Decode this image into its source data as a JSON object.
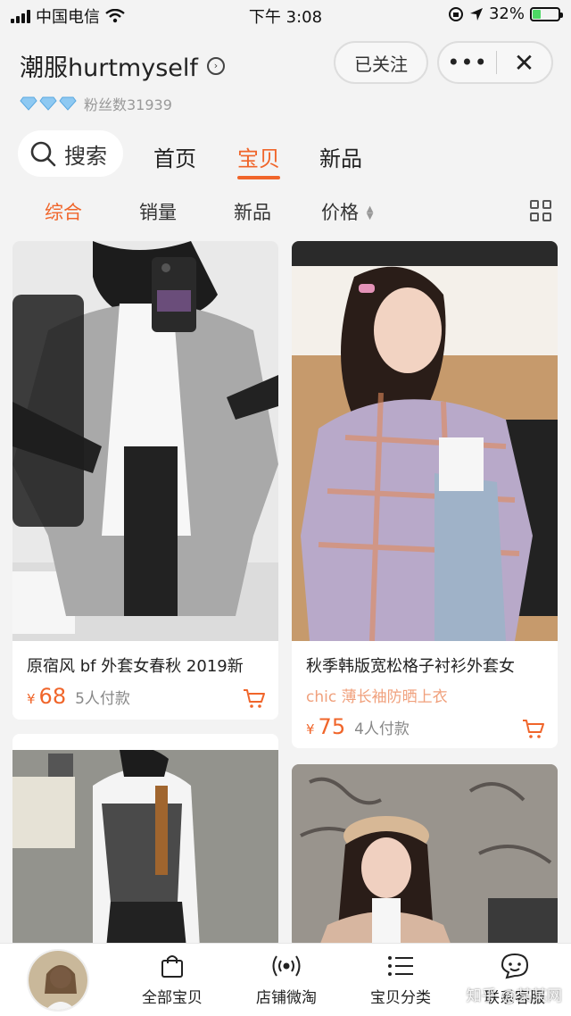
{
  "status_bar": {
    "carrier": "中国电信",
    "time": "下午 3:08",
    "battery": "32%",
    "battery_level": 0.32
  },
  "shop": {
    "name": "潮服hurtmyself",
    "fans_label": "粉丝数31939",
    "follow_label": "已关注",
    "more_label": "•••",
    "close_label": "✕"
  },
  "nav": {
    "search_label": "搜索",
    "tabs": [
      {
        "label": "首页"
      },
      {
        "label": "宝贝"
      },
      {
        "label": "新品"
      }
    ],
    "active_tab": "宝贝"
  },
  "sort": {
    "options": [
      {
        "label": "综合"
      },
      {
        "label": "销量"
      },
      {
        "label": "新品"
      },
      {
        "label": "价格"
      }
    ],
    "active": "综合"
  },
  "products": [
    {
      "title": "原宿风 bf 外套女春秋 2019新",
      "subtitle": "",
      "currency": "¥",
      "price": "68",
      "sold": "5人付款"
    },
    {
      "title": "秋季韩版宽松格子衬衫外套女",
      "subtitle": "chic 薄长袖防晒上衣",
      "currency": "¥",
      "price": "75",
      "sold": "4人付款"
    },
    {
      "title": "",
      "subtitle": "",
      "currency": "",
      "price": "",
      "sold": ""
    },
    {
      "title": "",
      "subtitle": "",
      "currency": "",
      "price": "",
      "sold": ""
    }
  ],
  "bottom_bar": {
    "items": [
      {
        "label": "全部宝贝",
        "icon": "shopping-bag-icon"
      },
      {
        "label": "店铺微淘",
        "icon": "broadcast-icon"
      },
      {
        "label": "宝贝分类",
        "icon": "list-icon"
      },
      {
        "label": "联系客服",
        "icon": "chat-face-icon"
      }
    ],
    "watermark": "知乎 @某某网"
  },
  "colors": {
    "accent": "#f0652a",
    "background": "#f3f3f3"
  }
}
